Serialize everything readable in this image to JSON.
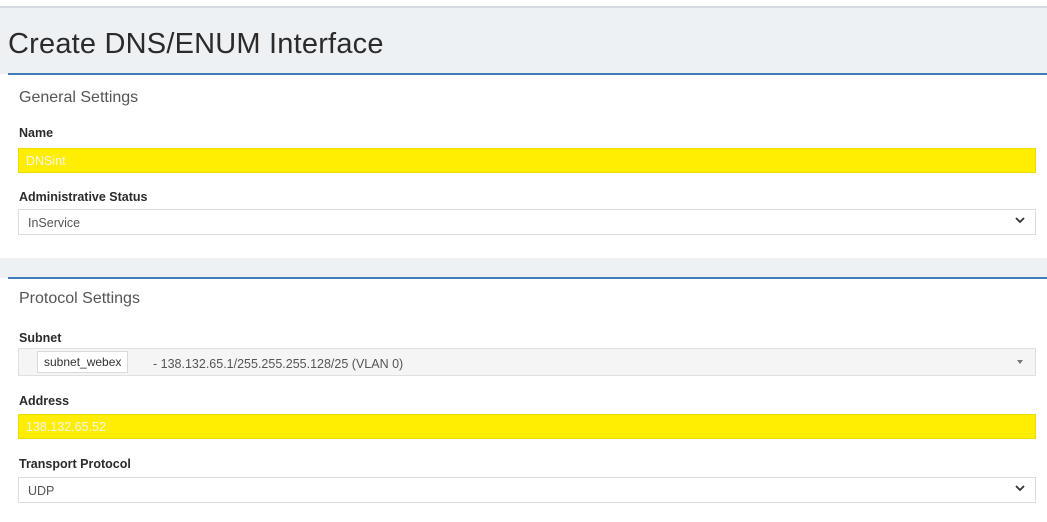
{
  "page": {
    "title": "Create DNS/ENUM Interface"
  },
  "general_settings": {
    "title": "General Settings",
    "name": {
      "label": "Name",
      "value": "DNSint"
    },
    "admin_status": {
      "label": "Administrative Status",
      "value": "InService"
    }
  },
  "protocol_settings": {
    "title": "Protocol Settings",
    "subnet": {
      "label": "Subnet",
      "tag": "subnet_webex",
      "value": "- 138.132.65.1/255.255.255.128/25 (VLAN 0)"
    },
    "address": {
      "label": "Address",
      "value": "138.132.65.52"
    },
    "transport_protocol": {
      "label": "Transport Protocol",
      "value": "UDP"
    }
  },
  "colors": {
    "accent_border": "#3d7fb6",
    "highlight_field": "#ffee00",
    "header_bg": "#eef1f4"
  },
  "icons": {
    "dropdown": "chevron-down-icon",
    "small_dropdown": "caret-down-icon"
  }
}
